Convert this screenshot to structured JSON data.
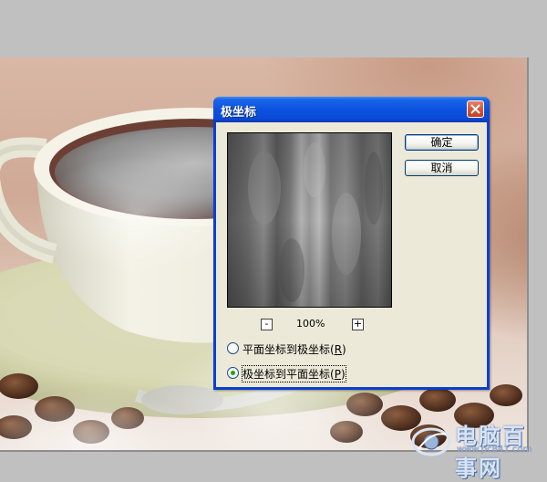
{
  "dialog": {
    "title": "极坐标",
    "ok_label": "确定",
    "cancel_label": "取消",
    "zoom": "100%",
    "zoom_out": "-",
    "zoom_in": "+",
    "options": [
      {
        "label": "平面坐标到极坐标",
        "mnemonic": "R",
        "selected": false
      },
      {
        "label": "极坐标到平面坐标",
        "mnemonic": "P",
        "selected": true
      }
    ]
  },
  "watermark": {
    "text": "电脑百事网",
    "url": "www.pc841.com"
  },
  "colors": {
    "titlebar": "#0a52df",
    "dialog_bg": "#ece9d8",
    "close_button": "#d7563a",
    "radio_dot": "#21a121"
  }
}
